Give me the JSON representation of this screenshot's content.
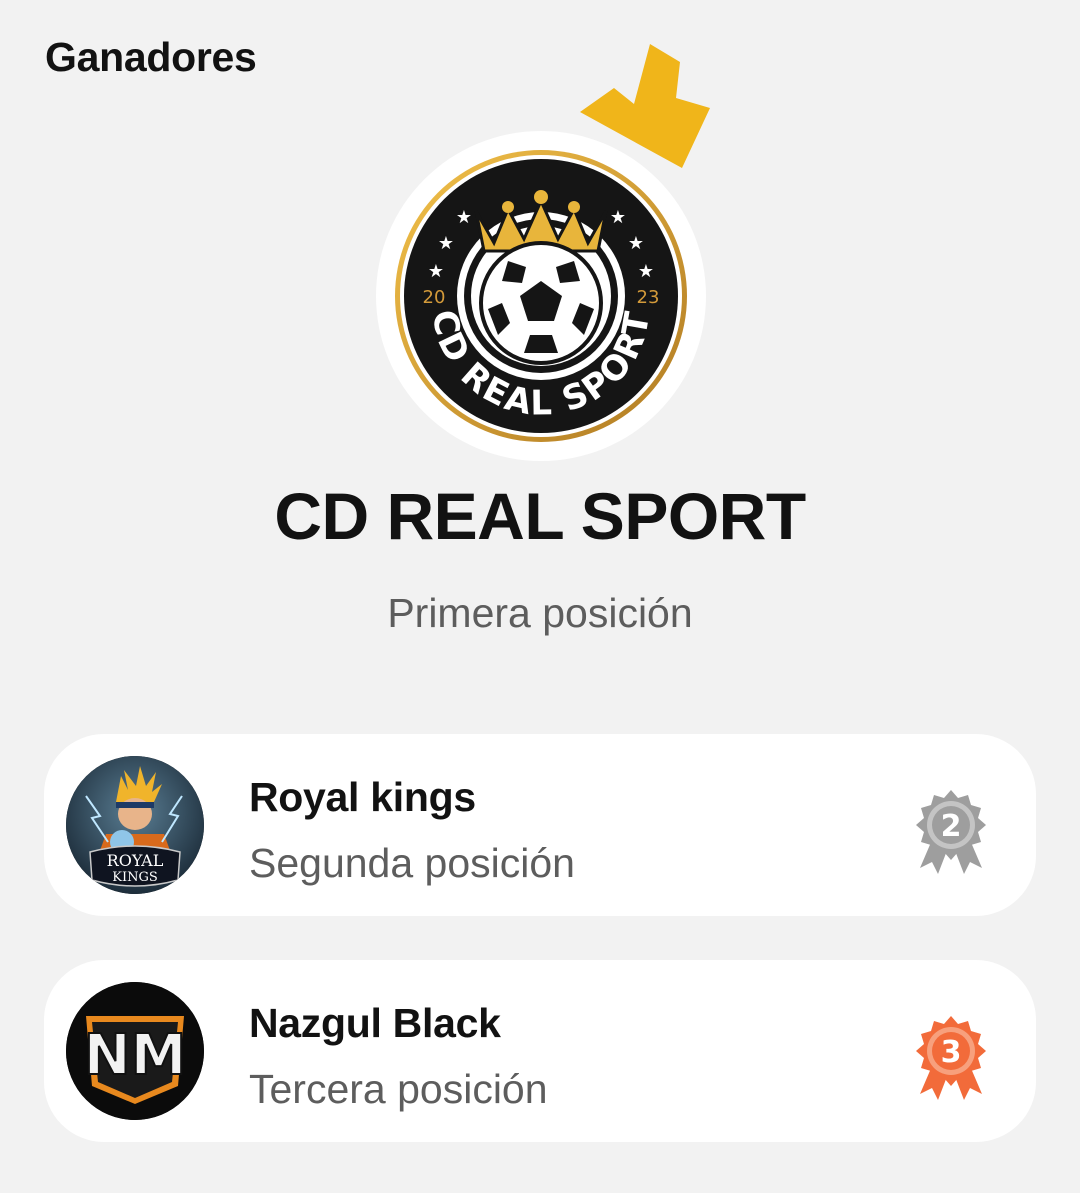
{
  "header": {
    "title": "Ganadores"
  },
  "winner": {
    "name": "CD REAL SPORT",
    "position": "Primera posición",
    "crown_icon": "crown-icon",
    "logo": {
      "icon": "soccer-ball-icon",
      "year_left": "20",
      "year_right": "23",
      "text": "CD REAL SPORT"
    },
    "crown_color": "#F0B51A"
  },
  "rankings": [
    {
      "name": "Royal kings",
      "position": "Segunda posición",
      "avatar_text_1": "ROYAL",
      "avatar_text_2": "KINGS",
      "medal_number": "2",
      "medal_color": "#9e9e9e"
    },
    {
      "name": "Nazgul Black",
      "position": "Tercera posición",
      "avatar_text": "NM",
      "medal_number": "3",
      "medal_color": "#f26b3a"
    }
  ]
}
